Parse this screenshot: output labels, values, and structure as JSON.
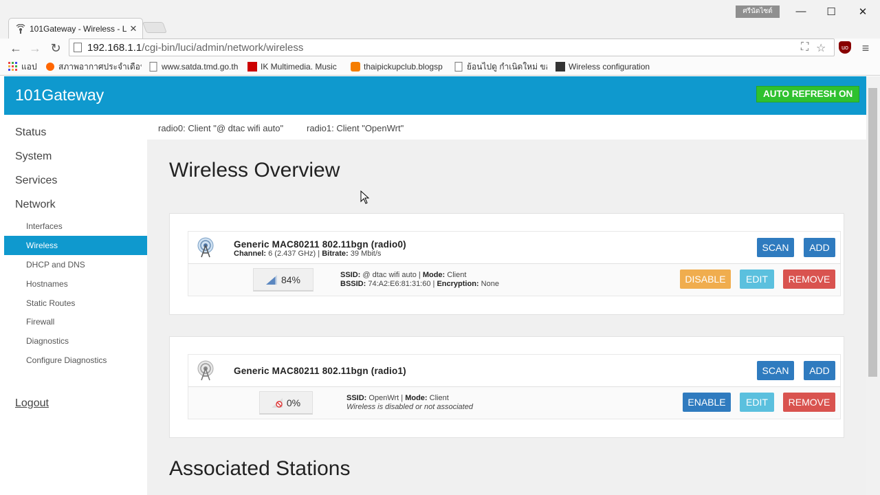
{
  "browser": {
    "tab_title": "101Gateway - Wireless - L",
    "tab_close": "✕",
    "profile_badge": "ศรีนัดไซต์",
    "url_host": "192.168.1.1",
    "url_path": "/cgi-bin/luci/admin/network/wireless",
    "window_controls": {
      "minimize": "—",
      "maximize": "☐",
      "close": "✕"
    },
    "bookmarks": [
      {
        "label": "แอป",
        "icon": "apps-grid-icon"
      },
      {
        "label": "สภาพอากาศประจำเดือนนี้",
        "icon": "weather-icon"
      },
      {
        "label": "www.satda.tmd.go.th",
        "icon": "page-icon"
      },
      {
        "label": "IK Multimedia. Music",
        "icon": "ik-icon"
      },
      {
        "label": "thaipickupclub.blogsp",
        "icon": "blogger-icon"
      },
      {
        "label": "ย้อนไปดู กำเนิดใหม่ ของเร",
        "icon": "page-icon"
      },
      {
        "label": "Wireless configuration",
        "icon": "openwrt-icon"
      }
    ]
  },
  "header": {
    "brand": "101Gateway",
    "auto_refresh": "AUTO REFRESH ON"
  },
  "sidebar": {
    "top_items": [
      "Status",
      "System",
      "Services",
      "Network"
    ],
    "network_items": [
      "Interfaces",
      "Wireless",
      "DHCP and DNS",
      "Hostnames",
      "Static Routes",
      "Firewall",
      "Diagnostics",
      "Configure Diagnostics"
    ],
    "active_item": "Wireless",
    "logout": "Logout"
  },
  "radio_bar": {
    "radio0": "radio0: Client \"@ dtac wifi auto\"",
    "radio1": "radio1: Client \"OpenWrt\""
  },
  "main": {
    "title": "Wireless Overview",
    "stations_title": "Associated Stations"
  },
  "devices": [
    {
      "name": "Generic MAC80211 802.11bgn (radio0)",
      "channel_label": "Channel:",
      "channel": "6 (2.437 GHz)",
      "bitrate_label": "Bitrate:",
      "bitrate": "39 Mbit/s",
      "signal": "84%",
      "signal_fraction": 0.84,
      "ssid_label": "SSID:",
      "ssid": "@ dtac wifi auto",
      "mode_label": "Mode:",
      "mode": "Client",
      "bssid_label": "BSSID:",
      "bssid": "74:A2:E6:81:31:60",
      "encryption_label": "Encryption:",
      "encryption": "None",
      "buttons": {
        "scan": "SCAN",
        "add": "ADD",
        "toggle": "DISABLE",
        "edit": "EDIT",
        "remove": "REMOVE"
      }
    },
    {
      "name": "Generic MAC80211 802.11bgn (radio1)",
      "signal": "0%",
      "signal_fraction": 0.0,
      "ssid_label": "SSID:",
      "ssid": "OpenWrt",
      "mode_label": "Mode:",
      "mode": "Client",
      "status": "Wireless is disabled or not associated",
      "buttons": {
        "scan": "SCAN",
        "add": "ADD",
        "toggle": "ENABLE",
        "edit": "EDIT",
        "remove": "REMOVE"
      }
    }
  ],
  "colors": {
    "header": "#0f99ce",
    "auto_refresh": "#2fc12f",
    "btn_primary": "#2f7bbf",
    "btn_warning": "#f0ad4e",
    "btn_info": "#5bc0de",
    "btn_danger": "#d9534f"
  }
}
